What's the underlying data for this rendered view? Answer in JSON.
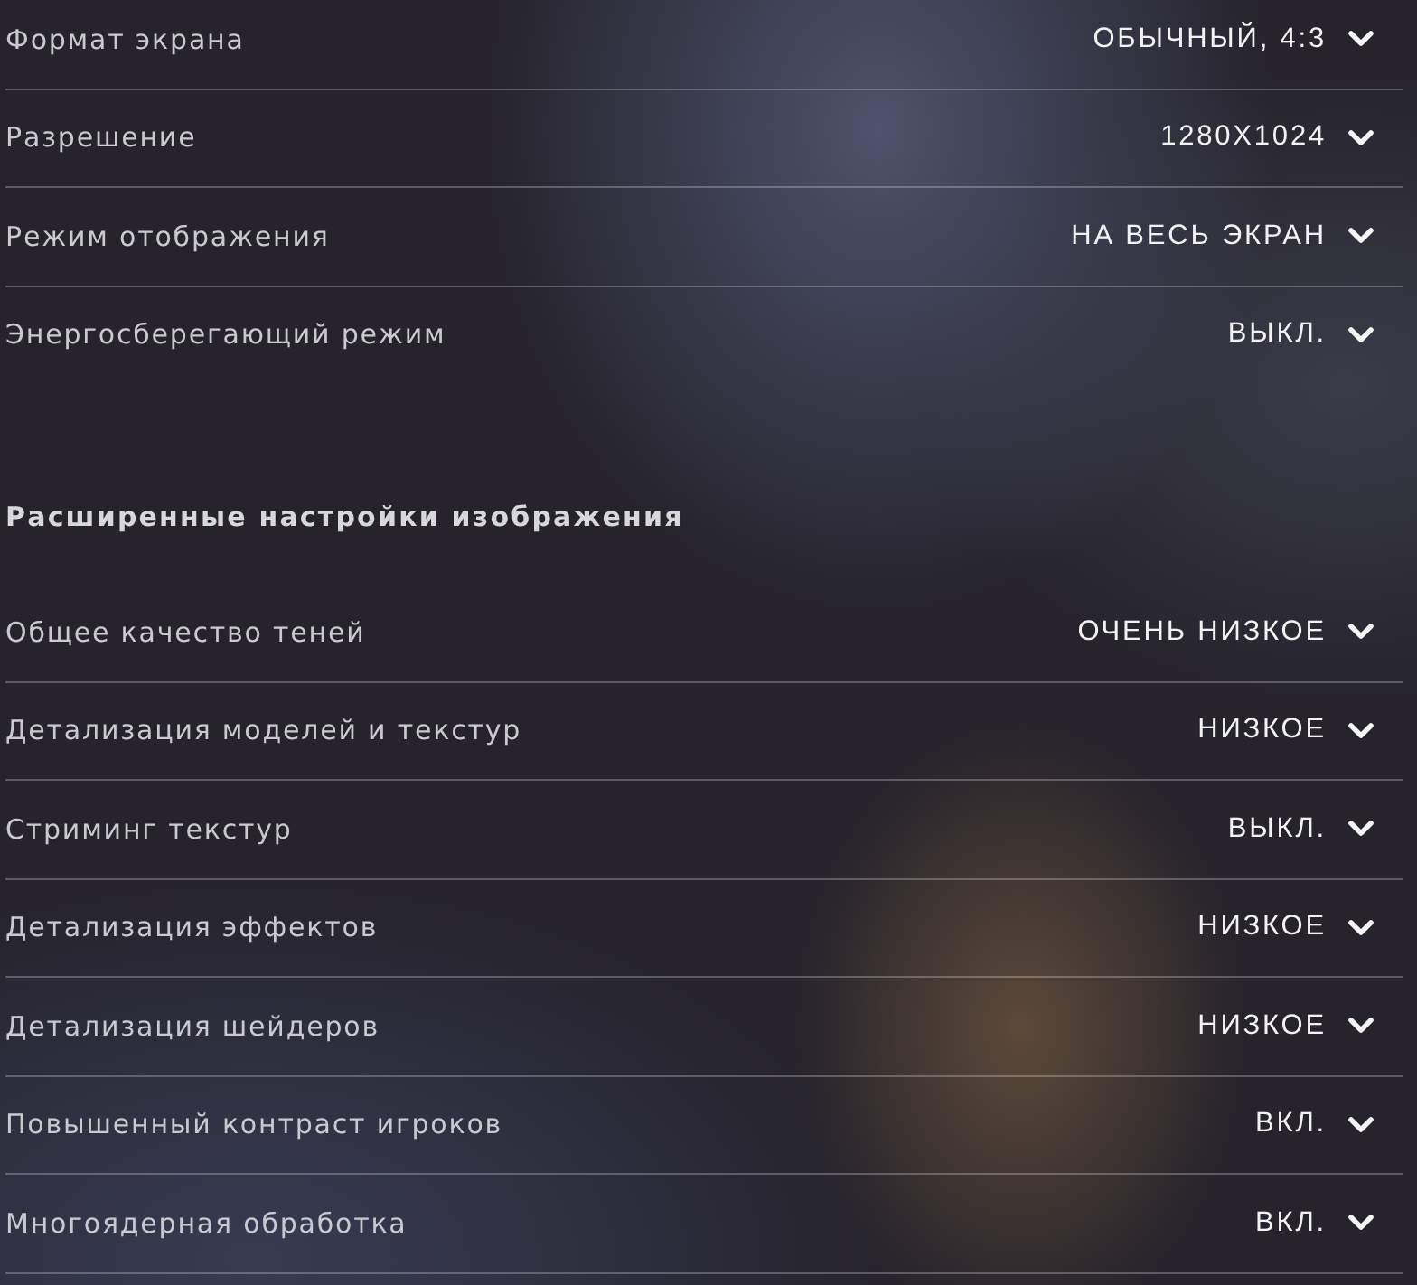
{
  "sections": [
    {
      "rows": [
        {
          "label": "Формат экрана",
          "value": "ОБЫЧНЫЙ, 4:3"
        },
        {
          "label": "Разрешение",
          "value": "1280X1024"
        },
        {
          "label": "Режим отображения",
          "value": "НА ВЕСЬ ЭКРАН"
        },
        {
          "label": "Энергосберегающий режим",
          "value": "ВЫКЛ."
        }
      ]
    },
    {
      "heading": "Расширенные настройки изображения",
      "rows": [
        {
          "label": "Общее качество теней",
          "value": "ОЧЕНЬ НИЗКОЕ"
        },
        {
          "label": "Детализация моделей и текстур",
          "value": "НИЗКОЕ"
        },
        {
          "label": "Стриминг текстур",
          "value": "ВЫКЛ."
        },
        {
          "label": "Детализация эффектов",
          "value": "НИЗКОЕ"
        },
        {
          "label": "Детализация шейдеров",
          "value": "НИЗКОЕ"
        },
        {
          "label": "Повышенный контраст игроков",
          "value": "ВКЛ."
        },
        {
          "label": "Многоядерная обработка",
          "value": "ВКЛ."
        }
      ]
    }
  ]
}
